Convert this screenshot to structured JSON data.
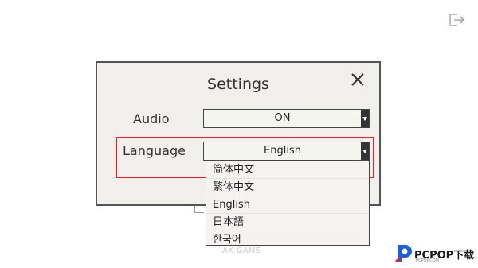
{
  "dialog": {
    "title": "Settings",
    "audio": {
      "label": "Audio",
      "value": "ON"
    },
    "language": {
      "label": "Language",
      "value": "English",
      "options": [
        "简体中文",
        "繁体中文",
        "English",
        "日本語",
        "한국어"
      ]
    }
  },
  "watermark": "AX-GAME",
  "brand": {
    "name": "PCPOP下载",
    "tagline": "PCPOP.COM"
  },
  "colors": {
    "highlight": "#e0242b",
    "dialog_bg": "#f2f0ec",
    "brand_blue": "#1e5fd9"
  },
  "icons": {
    "exit": "exit-icon",
    "close": "close-icon",
    "dropdown_arrow": "caret-down-icon"
  }
}
